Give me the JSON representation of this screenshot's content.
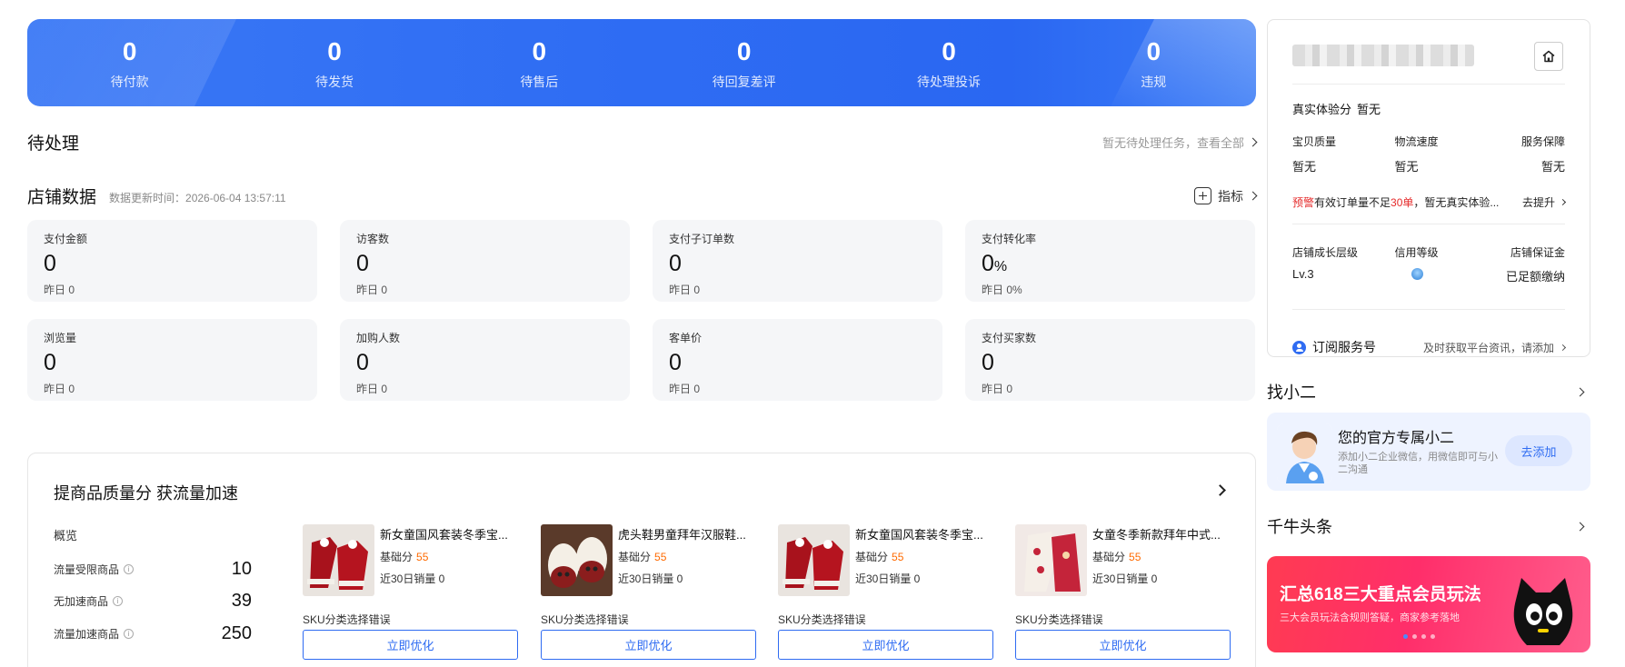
{
  "stats": [
    {
      "value": "0",
      "label": "待付款"
    },
    {
      "value": "0",
      "label": "待发货"
    },
    {
      "value": "0",
      "label": "待售后"
    },
    {
      "value": "0",
      "label": "待回复差评"
    },
    {
      "value": "0",
      "label": "待处理投诉"
    },
    {
      "value": "0",
      "label": "违规"
    }
  ],
  "pending": {
    "title": "待处理",
    "link": "暂无待处理任务，查看全部"
  },
  "shop_data": {
    "title": "店铺数据",
    "update_time": "数据更新时间：2026-06-04 13:57:11",
    "metrics_link": "指标",
    "metrics": [
      {
        "label": "支付金额",
        "value": "0",
        "unit": "",
        "yesterday": "昨日 0"
      },
      {
        "label": "访客数",
        "value": "0",
        "unit": "",
        "yesterday": "昨日 0"
      },
      {
        "label": "支付子订单数",
        "value": "0",
        "unit": "",
        "yesterday": "昨日 0"
      },
      {
        "label": "支付转化率",
        "value": "0",
        "unit": "%",
        "yesterday": "昨日 0%"
      },
      {
        "label": "浏览量",
        "value": "0",
        "unit": "",
        "yesterday": "昨日 0"
      },
      {
        "label": "加购人数",
        "value": "0",
        "unit": "",
        "yesterday": "昨日 0"
      },
      {
        "label": "客单价",
        "value": "0",
        "unit": "",
        "yesterday": "昨日 0"
      },
      {
        "label": "支付买家数",
        "value": "0",
        "unit": "",
        "yesterday": "昨日 0"
      }
    ]
  },
  "quality": {
    "title": "提商品质量分 获流量加速",
    "overview": "概览",
    "rows": [
      {
        "label": "流量受限商品",
        "value": "10"
      },
      {
        "label": "无加速商品",
        "value": "39"
      },
      {
        "label": "流量加速商品",
        "value": "250"
      }
    ],
    "products": [
      {
        "name": "新女童国风套装冬季宝...",
        "score_label": "基础分",
        "score": "55",
        "sales": "近30日销量 0",
        "error": "SKU分类选择错误",
        "button": "立即优化"
      },
      {
        "name": "虎头鞋男童拜年汉服鞋...",
        "score_label": "基础分",
        "score": "55",
        "sales": "近30日销量 0",
        "error": "SKU分类选择错误",
        "button": "立即优化"
      },
      {
        "name": "新女童国风套装冬季宝...",
        "score_label": "基础分",
        "score": "55",
        "sales": "近30日销量 0",
        "error": "SKU分类选择错误",
        "button": "立即优化"
      },
      {
        "name": "女童冬季新款拜年中式...",
        "score_label": "基础分",
        "score": "55",
        "sales": "近30日销量 0",
        "error": "SKU分类选择错误",
        "button": "立即优化"
      }
    ]
  },
  "account": {
    "experience_label": "真实体验分",
    "experience_value": "暂无",
    "sub_labels": [
      "宝贝质量",
      "物流速度",
      "服务保障"
    ],
    "sub_values": [
      "暂无",
      "暂无",
      "暂无"
    ],
    "warning_tag": "预警",
    "warning_text_a": "有效订单量不足",
    "warning_count": "30单",
    "warning_text_b": "，暂无真实体验...",
    "improve": "去提升",
    "growth_labels": [
      "店铺成长层级",
      "信用等级",
      "店铺保证金"
    ],
    "growth_level": "Lv.3",
    "deposit_status": "已足额缴纳",
    "subscribe_label": "订阅服务号",
    "subscribe_hint": "及时获取平台资讯，请添加"
  },
  "xiaoer": {
    "section_title": "找小二",
    "title": "您的官方专属小二",
    "desc": "添加小二企业微信，用微信即可与小二沟通",
    "button": "去添加"
  },
  "headlines": {
    "section_title": "千牛头条",
    "banner_title": "汇总618三大重点会员玩法",
    "banner_sub": "三大会员玩法含规则答疑，商家参考落地"
  },
  "colors": {
    "brand_blue": "#2e6bf2",
    "score_orange": "#ff6a00",
    "warning_red": "#e52b2b",
    "deposit_green": "#12b76a"
  }
}
